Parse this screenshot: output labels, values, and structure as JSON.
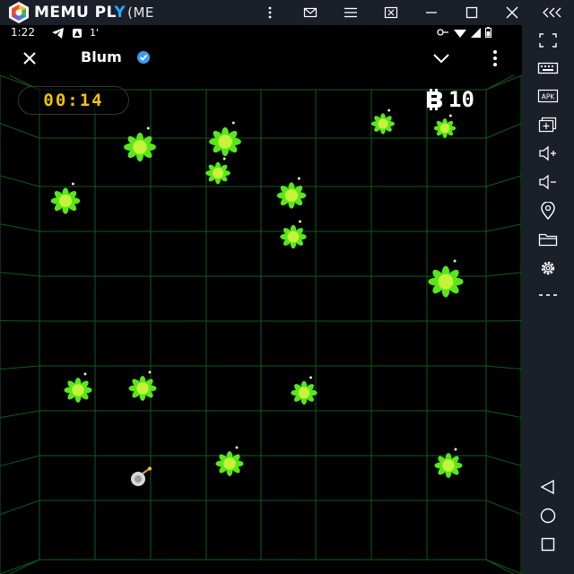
{
  "emulator": {
    "brand": "MEMU PL",
    "brand_play": "Y",
    "brand_suffix": "(ME",
    "titlebar_buttons": [
      "more-vertical-icon",
      "mail-icon",
      "menu-icon",
      "screenshot-icon",
      "minimize-icon",
      "maximize-icon",
      "close-icon",
      "collapse-icon"
    ],
    "sidebar_buttons": [
      "fullscreen-icon",
      "keyboard-icon",
      "apk-icon",
      "add-window-icon",
      "volume-up-icon",
      "volume-down-icon",
      "location-icon",
      "folder-icon",
      "settings-icon",
      "more-icon",
      "back-icon",
      "home-icon",
      "recents-icon"
    ],
    "sidebar_apk_label": "APK"
  },
  "statusbar": {
    "time": "1:22",
    "extra": "1'"
  },
  "app": {
    "title": "Blum",
    "verified": true
  },
  "game": {
    "timer": "00:14",
    "score": "10",
    "colors": {
      "timer": "#f0c400",
      "flake": "#58e81a",
      "flake_core": "#c6f23a",
      "grid": "#0f5a1c"
    }
  }
}
